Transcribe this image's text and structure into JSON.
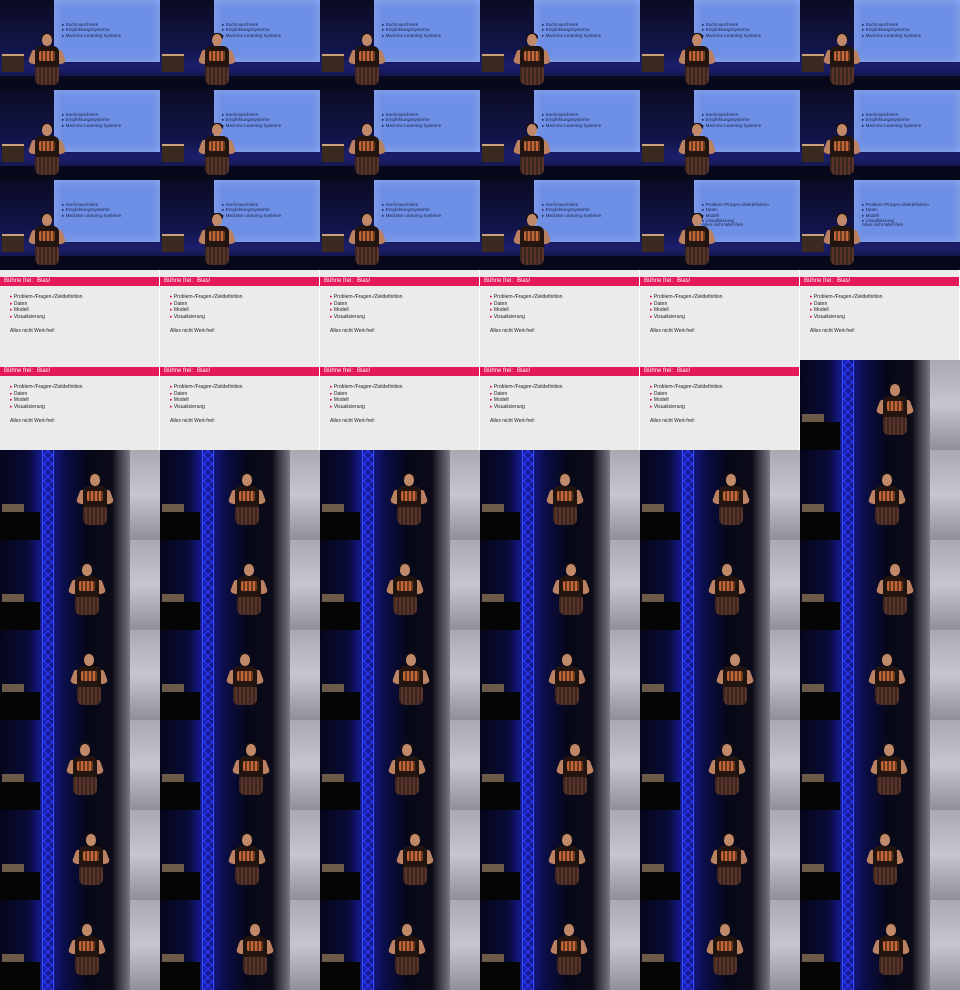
{
  "stage_slide": {
    "bullets": [
      "Suchmaschinen",
      "Empfehlungssysteme",
      "Machine Learning Systeme"
    ]
  },
  "stage_slide_bias": {
    "bullets": [
      "Problem-/Fragen-/Zieldefinition",
      "Daten",
      "Modell",
      "Visualisierung"
    ],
    "note": "Alles nicht Wert-frei!"
  },
  "slide": {
    "title_left": "Bühne frei:",
    "title_right": "Bias!",
    "bullets": [
      "Problem-/Fragen-/Zieldefinition",
      "Daten",
      "Modell",
      "Visualisierung"
    ],
    "note": "Alles nicht Wert-frei!"
  },
  "colors": {
    "accent": "#e3195a",
    "screen": "#6e8fe6",
    "truss": "#2a3bff"
  }
}
